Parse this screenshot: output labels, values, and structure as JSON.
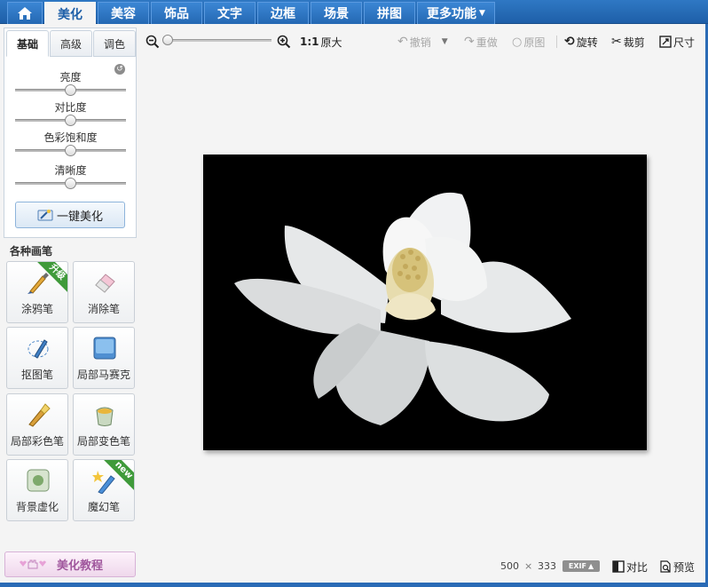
{
  "nav": {
    "tabs": [
      {
        "label": "美化"
      },
      {
        "label": "美容"
      },
      {
        "label": "饰品"
      },
      {
        "label": "文字"
      },
      {
        "label": "边框"
      },
      {
        "label": "场景"
      },
      {
        "label": "拼图"
      },
      {
        "label": "更多功能"
      }
    ],
    "active_tab": "美化",
    "colors": {
      "bar": "#2468b3",
      "accent": "#1e5fa8"
    }
  },
  "adjust_panel": {
    "tabs": [
      {
        "label": "基础"
      },
      {
        "label": "高级"
      },
      {
        "label": "调色"
      }
    ],
    "active_tab": "基础",
    "sliders": [
      {
        "label": "亮度",
        "value": 0.5
      },
      {
        "label": "对比度",
        "value": 0.5
      },
      {
        "label": "色彩饱和度",
        "value": 0.5
      },
      {
        "label": "清晰度",
        "value": 0.5
      }
    ],
    "one_click_label": "一键美化"
  },
  "brushes": {
    "heading": "各种画笔",
    "items": [
      {
        "label": "涂鸦笔",
        "icon": "doodle-brush-icon",
        "ribbon": "升级"
      },
      {
        "label": "消除笔",
        "icon": "eraser-icon"
      },
      {
        "label": "抠图笔",
        "icon": "cutout-pen-icon"
      },
      {
        "label": "局部马赛克",
        "icon": "mosaic-icon"
      },
      {
        "label": "局部彩色笔",
        "icon": "color-brush-icon"
      },
      {
        "label": "局部变色笔",
        "icon": "paint-bucket-icon"
      },
      {
        "label": "背景虚化",
        "icon": "blur-icon"
      },
      {
        "label": "魔幻笔",
        "icon": "magic-wand-icon",
        "ribbon": "new"
      }
    ]
  },
  "tutorial_label": "美化教程",
  "toolbar": {
    "zoom_ratio": "1:1",
    "original_size": "原大",
    "undo": "撤销",
    "redo": "重做",
    "restore": "原图",
    "rotate": "旋转",
    "crop": "裁剪",
    "resize": "尺寸",
    "zoom_level": 0.0
  },
  "status": {
    "width": "500",
    "times": "×",
    "height": "333",
    "exif": "EXIF",
    "compare": "对比",
    "preview": "预览"
  }
}
